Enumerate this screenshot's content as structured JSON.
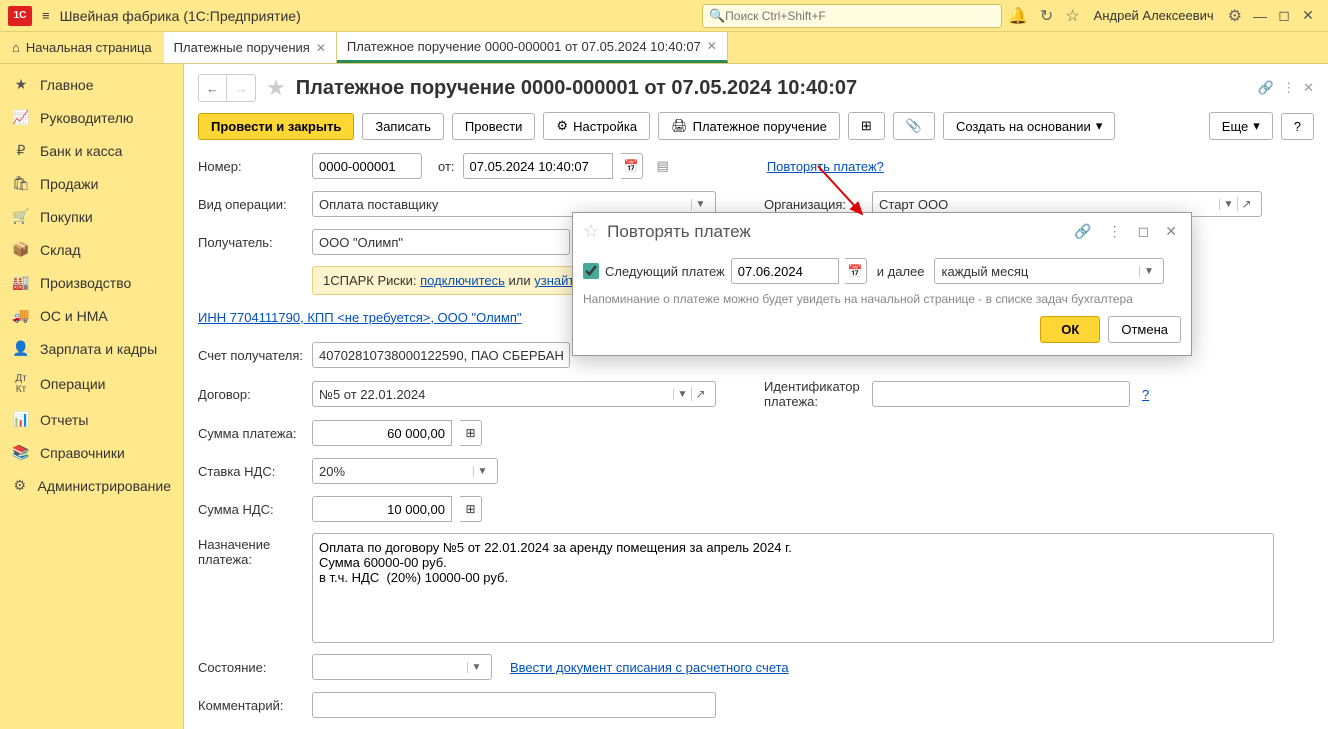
{
  "titlebar": {
    "app": "Швейная фабрика  (1С:Предприятие)",
    "search_placeholder": "Поиск Ctrl+Shift+F",
    "user": "Андрей Алексеевич"
  },
  "tabs": {
    "home": "Начальная страница",
    "t1": "Платежные поручения",
    "t2": "Платежное поручение 0000-000001 от 07.05.2024 10:40:07"
  },
  "nav": {
    "main": "Главное",
    "mgr": "Руководителю",
    "bank": "Банк и касса",
    "sales": "Продажи",
    "purch": "Покупки",
    "stock": "Склад",
    "prod": "Производство",
    "os": "ОС и НМА",
    "hr": "Зарплата и кадры",
    "ops": "Операции",
    "rep": "Отчеты",
    "ref": "Справочники",
    "adm": "Администрирование"
  },
  "doc": {
    "title": "Платежное поручение 0000-000001 от 07.05.2024 10:40:07",
    "save_close": "Провести и закрыть",
    "save": "Записать",
    "post": "Провести",
    "settings": "Настройка",
    "print": "Платежное поручение",
    "create_based": "Создать на основании",
    "more": "Еще"
  },
  "form": {
    "num_lbl": "Номер:",
    "num": "0000-000001",
    "from_lbl": "от:",
    "date": "07.05.2024 10:40:07",
    "repeat_link": "Повторять платеж?",
    "op_lbl": "Вид операции:",
    "op": "Оплата поставщику",
    "org_lbl": "Организация:",
    "org": "Старт ООО",
    "recv_lbl": "Получатель:",
    "recv": "ООО \"Олимп\"",
    "spark": "1СПАРК Риски: ",
    "spark_link1": "подключитесь",
    "spark_or": " или ",
    "spark_link2": "узнайте",
    "inn_link": "ИНН 7704111790, КПП <не требуется>,  ООО \"Олимп\"",
    "acct_lbl": "Счет получателя:",
    "acct": "40702810738000122590, ПАО СБЕРБАНК",
    "dog_lbl": "Договор:",
    "dog": "№5 от 22.01.2024",
    "ident_lbl": "Идентификатор платежа:",
    "sum_lbl": "Сумма платежа:",
    "sum": "60 000,00",
    "vat_rate_lbl": "Ставка НДС:",
    "vat_rate": "20%",
    "vat_sum_lbl": "Сумма НДС:",
    "vat_sum": "10 000,00",
    "purpose_lbl": "Назначение платежа:",
    "purpose": "Оплата по договору №5 от 22.01.2024 за аренду помещения за апрель 2024 г.\nСумма 60000-00 руб.\nв т.ч. НДС  (20%) 10000-00 руб.",
    "state_lbl": "Состояние:",
    "state_link": "Ввести документ списания с расчетного счета",
    "comment_lbl": "Комментарий:"
  },
  "dialog": {
    "title": "Повторять платеж",
    "next_lbl": "Следующий  платеж",
    "next_date": "07.06.2024",
    "further": "и далее",
    "freq": "каждый месяц",
    "note": "Напоминание о платеже можно будет увидеть на начальной странице - в списке задач бухгалтера",
    "ok": "ОК",
    "cancel": "Отмена"
  }
}
